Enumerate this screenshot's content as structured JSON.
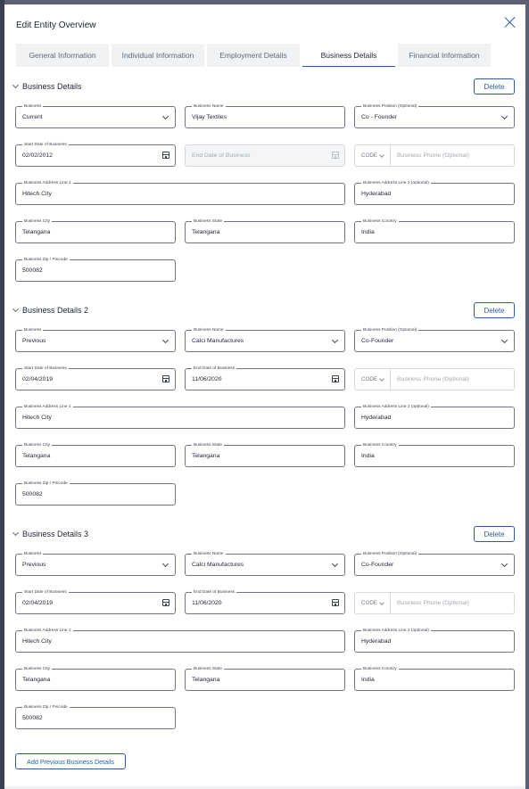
{
  "modal": {
    "title": "Edit Entity Overview"
  },
  "tabs": [
    {
      "label": "General Information",
      "active": false
    },
    {
      "label": "Individual Information",
      "active": false
    },
    {
      "label": "Employment Details",
      "active": false
    },
    {
      "label": "Business Details",
      "active": true
    },
    {
      "label": "Financial Information",
      "active": false
    }
  ],
  "labels": {
    "business": "Business",
    "business_name": "Business Name",
    "business_position": "Business Position (Optional)",
    "start_date": "Start Date of Business",
    "end_date": "End Date  of Business",
    "code": "CODE",
    "phone_placeholder": "Business Phone (Optional)",
    "address1": "Business Address Line 1",
    "address2": "Business Address Line 2 (optional)",
    "city": "Business City",
    "state": "Business State",
    "country": "Business Country",
    "zip": "Business Zip / Pincode",
    "delete": "Delete"
  },
  "sections": [
    {
      "title": "Business Details",
      "business": "Current",
      "business_name": "Vijay Textiles",
      "business_position": "Co - Founder",
      "start_date": "02/02/2012",
      "end_date_placeholder": "End Date  of Business",
      "address1": "Hitech City",
      "address2": "Hyderabad",
      "city": "Telangana",
      "state": "Telangana",
      "country": "India",
      "zip": "500082"
    },
    {
      "title": "Business Details 2",
      "business": "Previous",
      "business_name": "Calci Manufactures",
      "business_position": "Co-Founder",
      "start_date": "02/04/2019",
      "end_date": "11/06/2020",
      "address1": "Hitech City",
      "address2": "Hyderabad",
      "city": "Telangana",
      "state": "Telangana",
      "country": "India",
      "zip": "500082"
    },
    {
      "title": "Business Details 3",
      "business": "Previous",
      "business_name": "Calci Manufactures",
      "business_position": "Co-Founder",
      "start_date": "02/04/2019",
      "end_date": "11/06/2020",
      "address1": "Hitech City",
      "address2": "Hyderabad",
      "city": "Telangana",
      "state": "Telangana",
      "country": "India",
      "zip": "500082"
    }
  ],
  "footer": {
    "add_button": "Add Previous Business Details"
  },
  "colors": {
    "accent": "#2b5cab",
    "tab_bg": "#f1f2f4",
    "border": "#6f7684",
    "backdrop": "#5a6072"
  }
}
